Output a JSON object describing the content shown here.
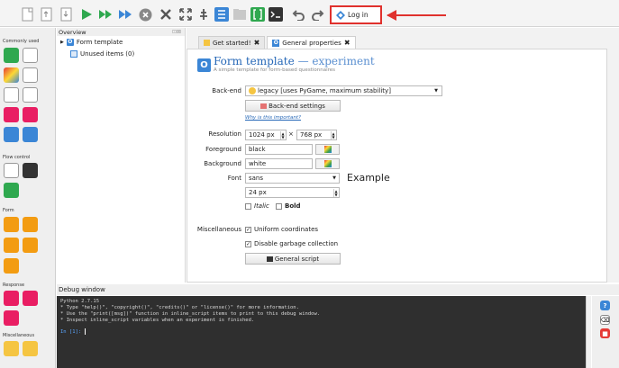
{
  "toolbar": {
    "login_label": "Log in",
    "icons": [
      "new-icon",
      "open-icon",
      "save-icon",
      "run-icon",
      "run-fast-icon",
      "run-quick-icon",
      "kill-icon",
      "close-icon",
      "fullscreen-icon",
      "pin-icon",
      "list-icon",
      "folder-icon",
      "brackets-icon",
      "terminal-icon",
      "undo-icon",
      "redo-icon"
    ]
  },
  "sidebar": {
    "sections": [
      "Commonly used",
      "Flow control",
      "Form",
      "Response",
      "Miscellaneous"
    ]
  },
  "overview": {
    "title": "Overview",
    "items": [
      "Form template",
      "Unused items (0)"
    ]
  },
  "tabs": [
    {
      "label": "Get started!"
    },
    {
      "label": "General properties"
    }
  ],
  "general": {
    "title": "Form template",
    "title_suffix": "— experiment",
    "subtitle": "A simple template for form-based questionnaires",
    "backend_label": "Back-end",
    "backend_value": "legacy [uses PyGame, maximum stability]",
    "backend_settings": "Back-end settings",
    "why_link": "Why is this important?",
    "resolution_label": "Resolution",
    "res_width": "1024 px",
    "res_x": "×",
    "res_height": "768 px",
    "foreground_label": "Foreground",
    "foreground_value": "black",
    "background_label": "Background",
    "background_value": "white",
    "font_label": "Font",
    "font_value": "sans",
    "font_example": "Example",
    "font_size": "24 px",
    "italic_label": "Italic",
    "bold_label": "Bold",
    "misc_label": "Miscellaneous",
    "uniform_label": "Uniform coordinates",
    "gc_label": "Disable garbage collection",
    "script_button": "General script"
  },
  "debug": {
    "title": "Debug window",
    "lines": [
      "Python 2.7.15",
      "",
      "",
      "* Type \"help()\", \"copyright()\", \"credits()\" or \"license()\" for more information.",
      "* Use the \"print([msg])\" function in inline_script items to print to this debug window.",
      "* Inspect inline_script variables when an experiment is finished."
    ],
    "prompt": "In [1]:"
  },
  "colors": {
    "accent": "#2567b7",
    "highlight": "#e0312d",
    "console_bg": "#2f2f2f"
  }
}
